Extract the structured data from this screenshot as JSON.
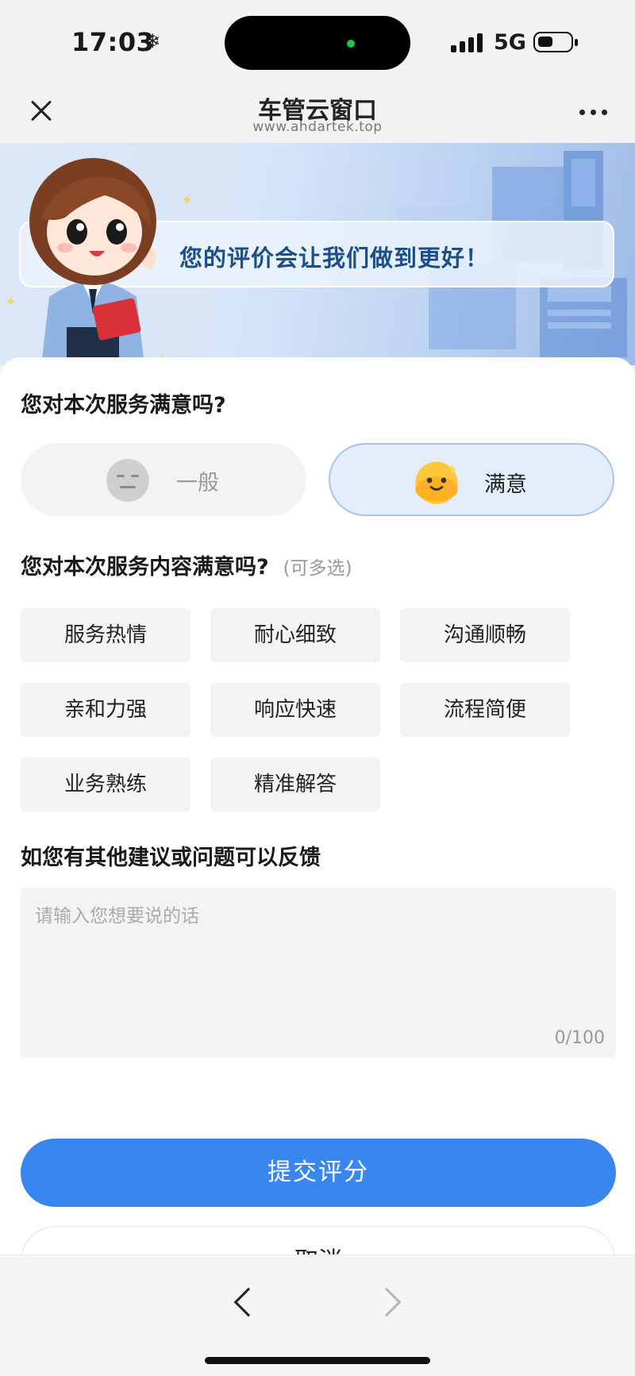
{
  "status_bar": {
    "time": "17:03",
    "weather_icon": "snowflake-icon",
    "network": "5G",
    "signal_icon": "cellular-signal-icon",
    "battery_icon": "battery-icon"
  },
  "navbar": {
    "title": "车管云窗口",
    "subtitle": "www.ahdartek.top",
    "close_icon": "close-icon",
    "more_icon": "more-dots-icon"
  },
  "banner": {
    "message": "您的评价会让我们做到更好！"
  },
  "rating": {
    "question": "您对本次服务满意吗?",
    "options": [
      {
        "label": "一般",
        "icon": "neutral-face-icon",
        "selected": false
      },
      {
        "label": "满意",
        "icon": "happy-face-icon",
        "selected": true
      }
    ]
  },
  "content": {
    "question": "您对本次服务内容满意吗?",
    "hint": "(可多选)",
    "tags": [
      "服务热情",
      "耐心细致",
      "沟通顺畅",
      "亲和力强",
      "响应快速",
      "流程简便",
      "业务熟练",
      "精准解答"
    ]
  },
  "feedback": {
    "title": "如您有其他建议或问题可以反馈",
    "placeholder": "请输入您想要说的话",
    "value": "",
    "counter": "0/100"
  },
  "actions": {
    "submit_label": "提交评分",
    "cancel_label": "取消"
  },
  "bottom_bar": {
    "back_icon": "chevron-left-icon",
    "forward_icon": "chevron-right-icon"
  },
  "colors": {
    "accent": "#3a86f0",
    "selected_bg": "#e4eefb",
    "selected_border": "#a6c4ea",
    "banner_text": "#1d4e86"
  }
}
